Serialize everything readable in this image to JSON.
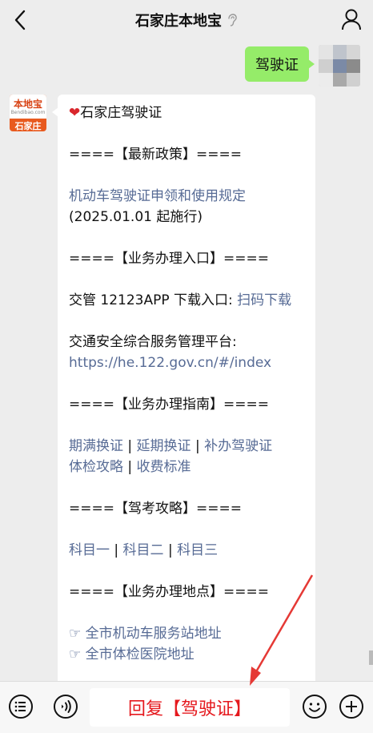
{
  "header": {
    "title": "石家庄本地宝",
    "back_icon": "chevron-left-icon",
    "profile_icon": "person-icon",
    "ear_icon": "ear-icon"
  },
  "user_message": {
    "text": "驾驶证"
  },
  "bot": {
    "avatar": {
      "brand": "本地宝",
      "domain": "Bendibao.com",
      "city": "石家庄"
    },
    "message": {
      "heading": "石家庄驾驶证",
      "section1": "====【最新政策】====",
      "policy_link": "机动车驾驶证申领和使用规定",
      "policy_date": "(2025.01.01 起施行)",
      "section2": "====【业务办理入口】====",
      "app_label": "交管 12123APP 下载入口:",
      "app_link": "扫码下载",
      "platform_label": "交通安全综合服务管理平台:",
      "platform_link": "https://he.122.gov.cn/#/index",
      "section3": "====【业务办理指南】====",
      "guide_links": [
        "期满换证",
        "延期换证",
        "补办驾驶证",
        "体检攻略",
        "收费标准"
      ],
      "section4": "====【驾考攻略】====",
      "exam_links": [
        "科目一",
        "科目二",
        "科目三"
      ],
      "section5": "====【业务办理地点】====",
      "location_links": [
        "全市机动车服务站地址",
        "全市体检医院地址"
      ],
      "pointer_glyph": "☞",
      "separator": "|"
    }
  },
  "footer": {
    "reply_text": "回复【驾驶证】",
    "menu_icon": "list-icon",
    "voice_icon": "voice-icon",
    "emoji_icon": "emoji-icon",
    "plus_icon": "plus-icon"
  },
  "colors": {
    "background": "#ededed",
    "user_bubble": "#95ec69",
    "link": "#576b95",
    "reply_text": "#e5191e",
    "arrow": "#e53935"
  }
}
